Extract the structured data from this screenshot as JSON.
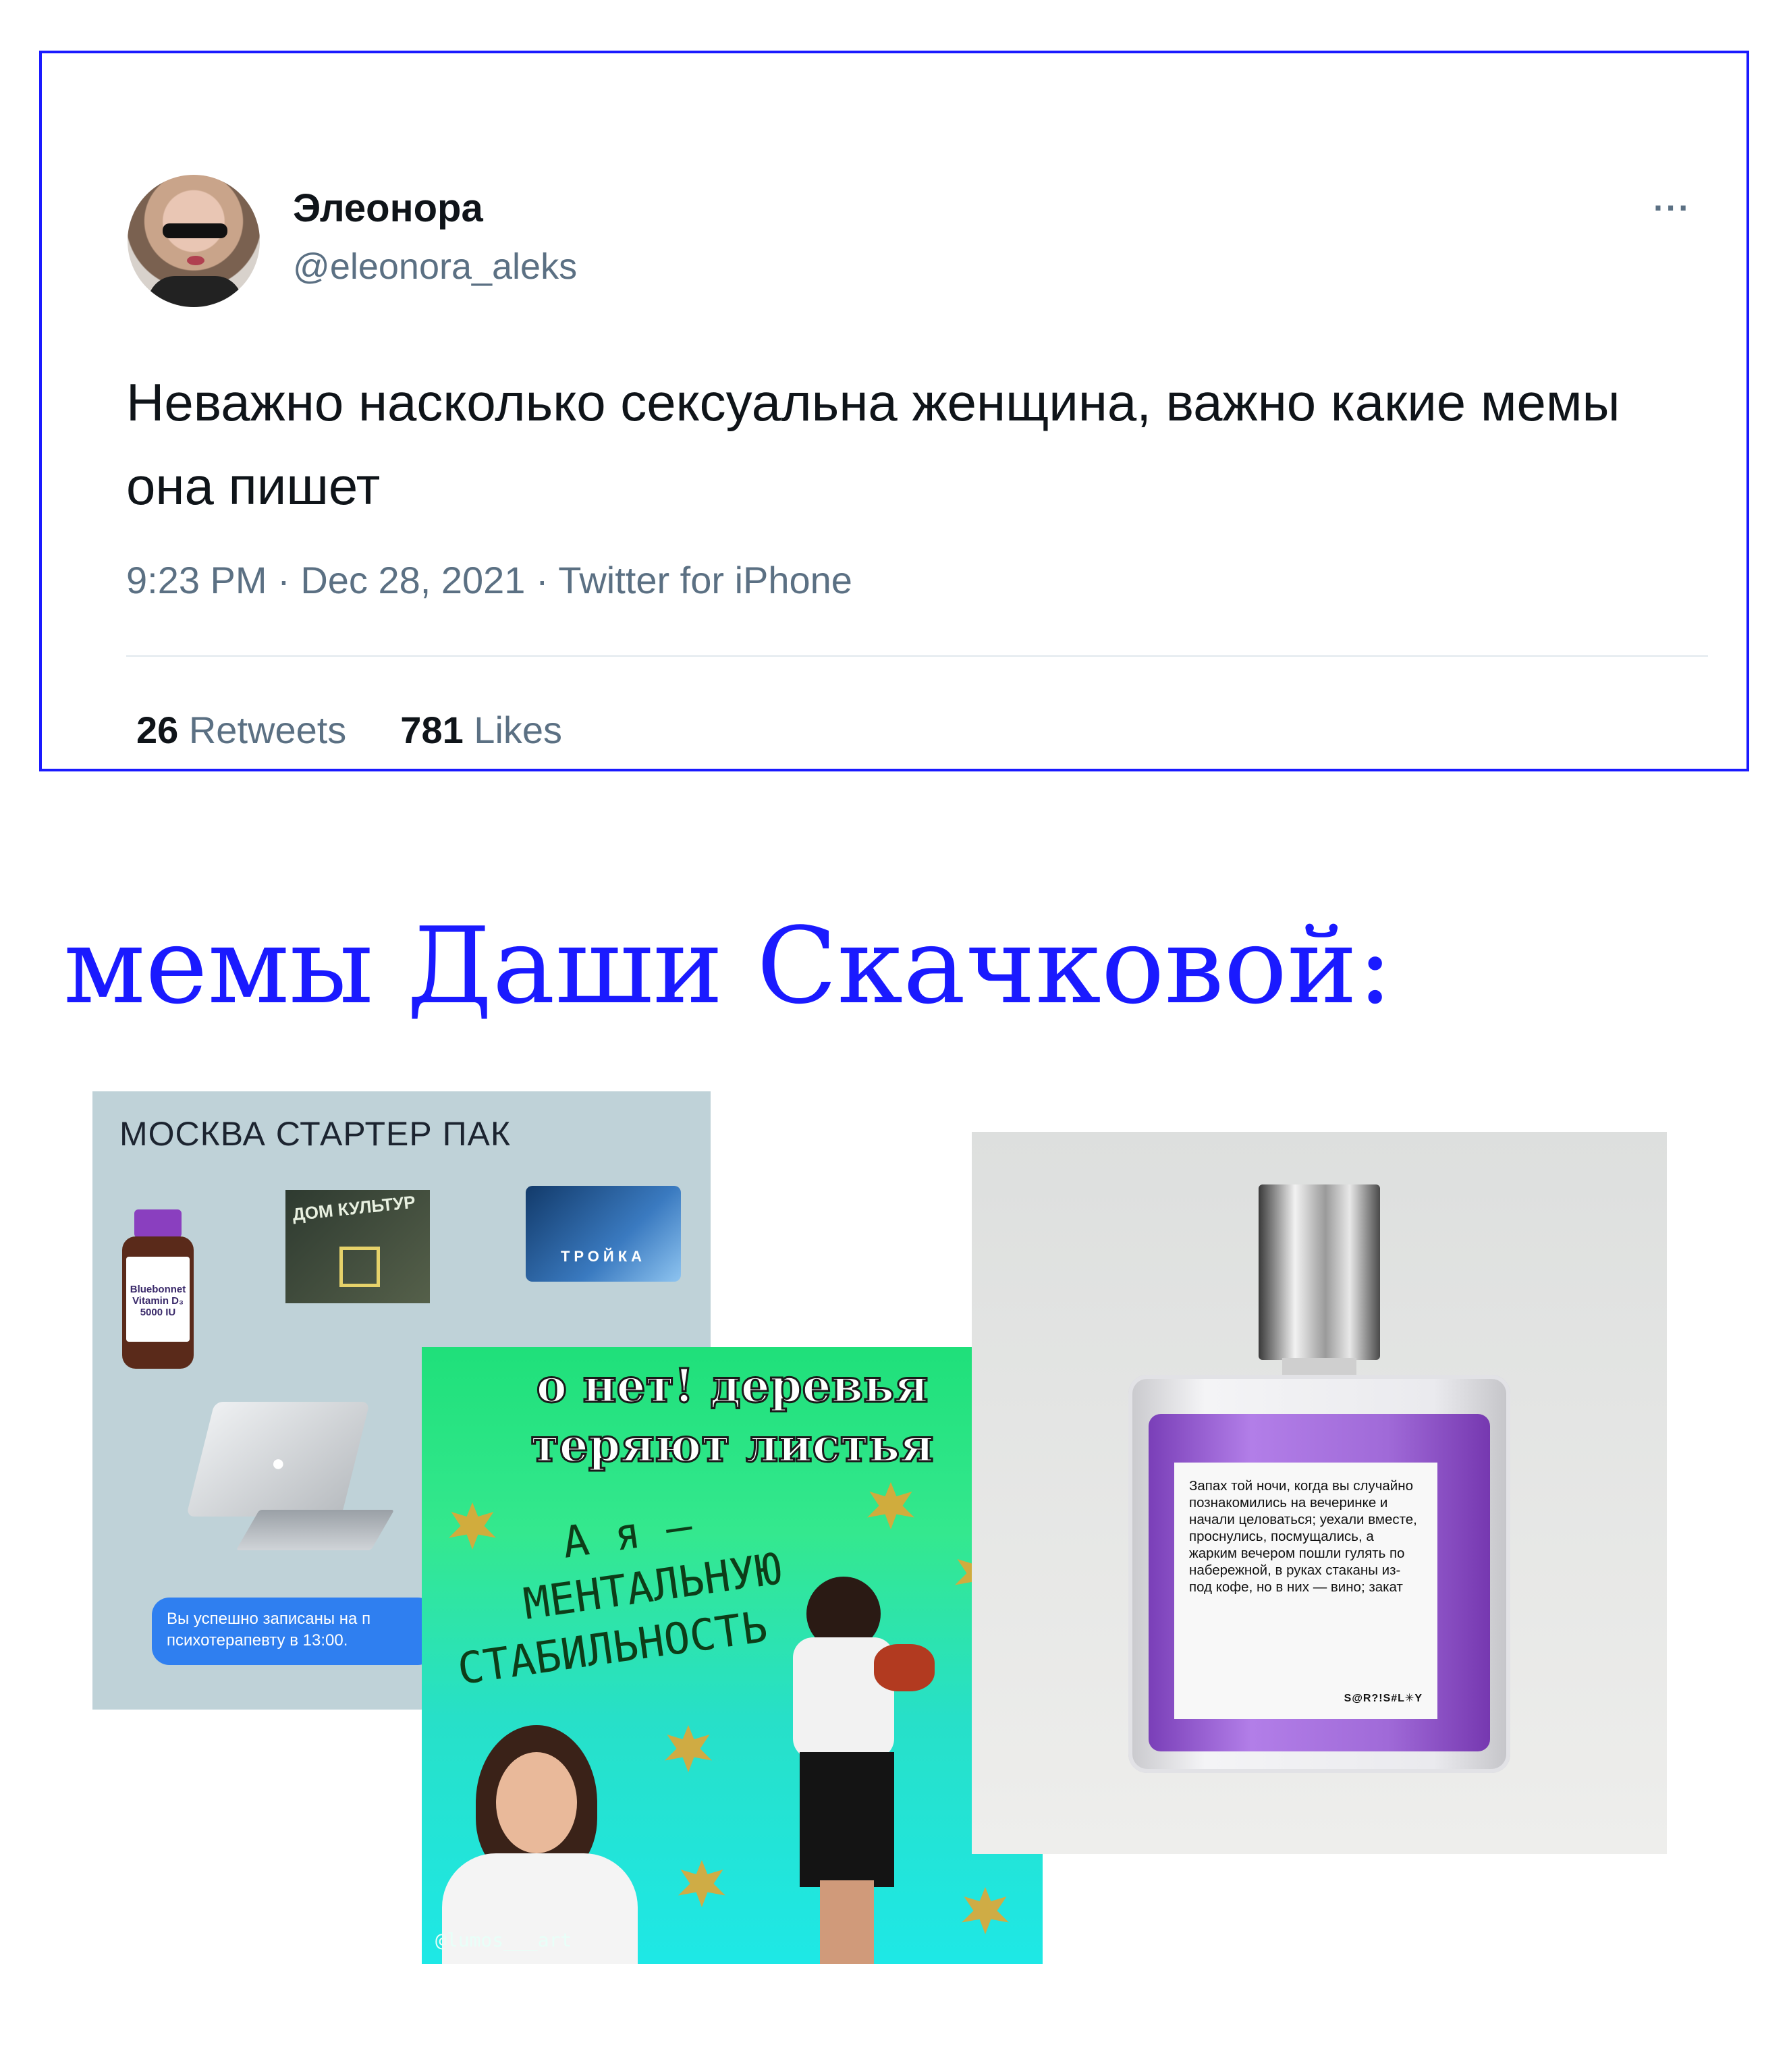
{
  "tweet": {
    "name": "Элеонора",
    "handle": "@eleonora_aleks",
    "more": "···",
    "text": "Неважно насколько сексуальна женщина, важно какие мемы она пишет",
    "meta": "9:23 PM · Dec 28, 2021 · Twitter for iPhone",
    "retweets_count": "26",
    "retweets_label": "Retweets",
    "likes_count": "781",
    "likes_label": "Likes"
  },
  "heading": "мемы Даши Скачковой:",
  "meme1": {
    "title": "МОСКВА СТАРТЕР ПАК",
    "bottle_brand": "Bluebonnet",
    "bottle_name": "Vitamin D₃",
    "bottle_dose": "5000 IU",
    "neon_text": "ДОМ КУЛЬТУР",
    "card_text": "ТРОЙКА",
    "notice": "Вы успешно записаны на п психотерапевту в 13:00."
  },
  "meme2": {
    "title_line1": "о нет! деревья",
    "title_line2": "теряют листья",
    "hand_line1": "А я —",
    "hand_line2": "МЕНТАЛЬНУЮ",
    "hand_line3": "СТАБИЛЬНОСТЬ",
    "watermark": "@lumos___art"
  },
  "meme3": {
    "label_text": "Запах той ночи, когда вы случайно познакомились на вечеринке и начали целоваться; уехали вместе, проснулись, посмущались, а жарким вечером пошли гулять по набережной, в руках стаканы из-под кофе, но в них — вино; закат",
    "brand": "S@R?!S#L✳Y"
  }
}
